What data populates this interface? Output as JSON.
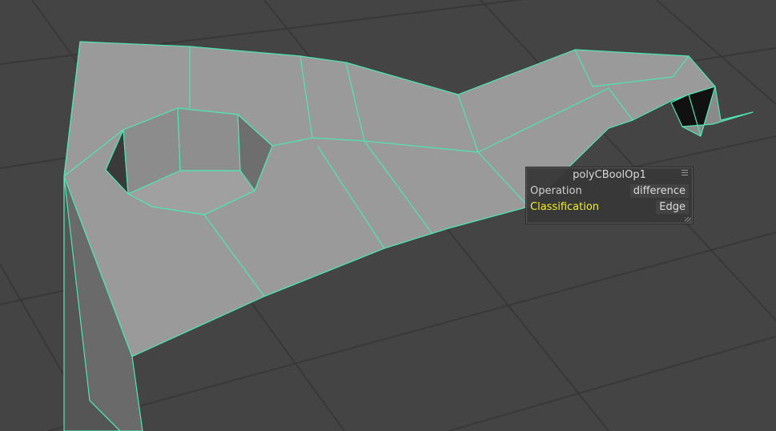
{
  "viewport": {
    "background_color": "#444444",
    "grid_color": "#373737",
    "face_color": "#999999",
    "wire_color": "#4fe6b0"
  },
  "hud": {
    "title": "polyCBoolOp1",
    "menu_icon": "menu-icon",
    "rows": [
      {
        "label": "Operation",
        "value": "difference",
        "active": false
      },
      {
        "label": "Classification",
        "value": "Edge",
        "active": true
      }
    ],
    "highlight_color": "#f2ee2c"
  }
}
